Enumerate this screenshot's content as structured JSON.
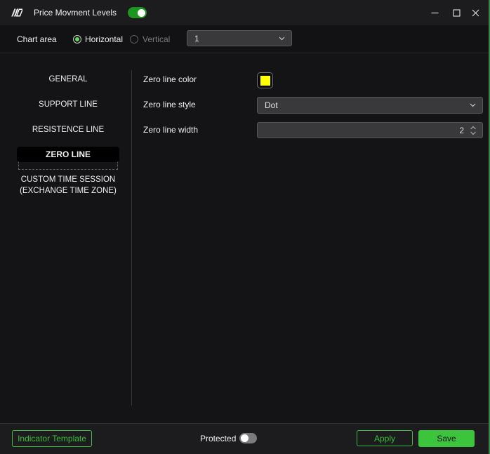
{
  "colors": {
    "accent_green": "#3CC43C",
    "title_toggle_green": "#1E9420",
    "radio_dot_green": "#5FDB5F",
    "window_edge_green": "#3E8144",
    "zero_line_color_value": "#FFFF00"
  },
  "titlebar": {
    "title": "Price Movment Levels",
    "indicator_enabled_toggle": "on"
  },
  "chart_area": {
    "label": "Chart area",
    "radio_horizontal": "Horizontal",
    "radio_vertical": "Vertical",
    "pane_select_value": "1"
  },
  "sidebar": {
    "items": [
      {
        "label": "GENERAL"
      },
      {
        "label": "SUPPORT LINE"
      },
      {
        "label": "RESISTENCE LINE"
      },
      {
        "label": "ZERO LINE",
        "selected": true
      },
      {
        "line1": "CUSTOM TIME SESSION",
        "line2": "(EXCHANGE TIME ZONE)"
      }
    ]
  },
  "form": {
    "rows": [
      {
        "label": "Zero line color",
        "control": "color-swatch",
        "value": "#FFFF00"
      },
      {
        "label": "Zero line style",
        "control": "combobox",
        "value": "Dot"
      },
      {
        "label": "Zero line width",
        "control": "spinbox",
        "value": "2"
      }
    ]
  },
  "footer": {
    "indicator_template_label": "Indicator Template",
    "protected_label": "Protected",
    "protected_toggle": "off",
    "apply_label": "Apply",
    "save_label": "Save"
  }
}
